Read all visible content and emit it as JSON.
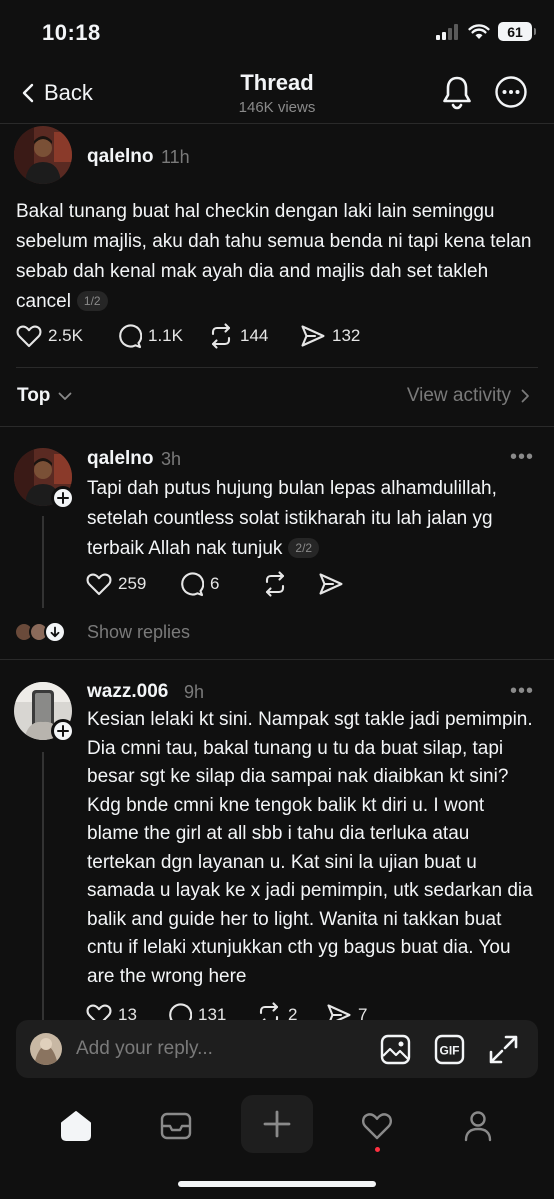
{
  "status_bar": {
    "time": "10:18",
    "battery": "61"
  },
  "header": {
    "back_label": "Back",
    "title": "Thread",
    "views": "146K views"
  },
  "main_post": {
    "username": "qalelno",
    "time": "11h",
    "text": "Bakal tunang buat hal checkin dengan laki lain seminggu sebelum majlis, aku dah tahu semua benda ni tapi kena telan sebab dah kenal mak ayah dia and majlis dah set takleh cancel",
    "page_badge": "1/2",
    "likes": "2.5K",
    "comments": "1.1K",
    "reposts": "144",
    "shares": "132"
  },
  "sort": {
    "label": "Top",
    "view_activity": "View activity"
  },
  "replies": [
    {
      "username": "qalelno",
      "time": "3h",
      "text": "Tapi dah putus hujung bulan lepas alhamdulillah, setelah countless solat istikharah itu lah jalan yg terbaik Allah nak tunjuk",
      "page_badge": "2/2",
      "likes": "259",
      "comments": "6",
      "show_replies": "Show replies"
    },
    {
      "username": "wazz.006",
      "time": "9h",
      "text": "Kesian lelaki kt sini. Nampak sgt takle jadi pemimpin. Dia cmni tau, bakal tunang u tu da buat silap, tapi besar sgt ke silap dia sampai nak diaibkan kt sini? Kdg bnde cmni kne tengok balik kt diri u. I wont blame the girl at all sbb i tahu dia terluka atau tertekan dgn layanan u. Kat sini la ujian buat u samada u layak ke x jadi pemimpin, utk sedarkan dia balik and guide her to light. Wanita ni takkan buat cntu if lelaki xtunjukkan cth yg bagus buat dia. You are the wrong here",
      "likes": "13",
      "comments": "131",
      "reposts": "2",
      "shares": "7"
    }
  ],
  "reply_bar": {
    "placeholder": "Add your reply..."
  },
  "tab_bar": {
    "items": [
      "home-icon",
      "inbox-icon",
      "create-icon",
      "activity-icon",
      "profile-icon"
    ]
  },
  "colors": {
    "background": "#101010",
    "text": "#f3f5f7",
    "muted": "#7a7a7a",
    "notification": "#ff3040"
  }
}
